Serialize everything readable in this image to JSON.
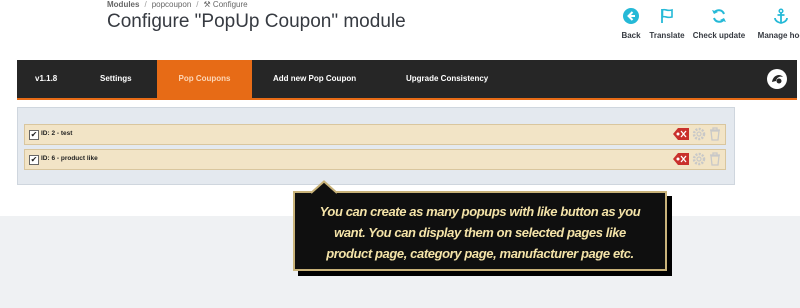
{
  "breadcrumb": {
    "modules": "Modules",
    "module": "popcoupon",
    "configure": "Configure"
  },
  "page": {
    "title": "Configure \"PopUp Coupon\" module"
  },
  "toolbar": {
    "back": "Back",
    "translate": "Translate",
    "check_update": "Check update",
    "manage_hooks": "Manage hoo"
  },
  "menu": {
    "version": "v1.1.8",
    "settings": "Settings",
    "pop_coupons": "Pop Coupons",
    "add_new": "Add new Pop Coupon",
    "upgrade": "Upgrade Consistency"
  },
  "coupons": [
    {
      "label": "ID: 2 - test",
      "checked": true
    },
    {
      "label": "ID: 6 - product like",
      "checked": true
    }
  ],
  "callout": {
    "line1": "You can create as many popups with like button as you",
    "line2": "want. You can display them on selected pages like",
    "line3": "product page, category page, manufacturer page etc."
  },
  "colors": {
    "accent": "#e76b16",
    "menu_bg": "#262626",
    "icon_blue": "#25b9d7",
    "callout_text": "#f4e3a8"
  }
}
